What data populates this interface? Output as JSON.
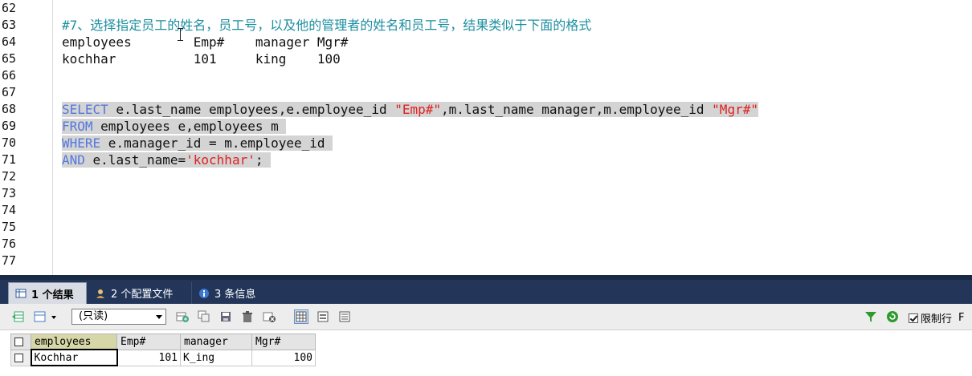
{
  "editor": {
    "lines": [
      {
        "n": "62"
      },
      {
        "n": "63",
        "comment": "#7、选择指定员工的姓名，员工号，以及他的管理者的姓名和员工号，结果类似于下面的格式"
      },
      {
        "n": "64",
        "text": "employees        Emp#    manager Mgr#"
      },
      {
        "n": "65",
        "text": "kochhar          101     king    100"
      },
      {
        "n": "66"
      },
      {
        "n": "67"
      },
      {
        "n": "68",
        "kw": "SELECT",
        "rest1": " e.last_name employees,e.employee_id ",
        "str1": "\"Emp#\"",
        "rest2": ",m.last_name manager,m.employee_id ",
        "str2": "\"Mgr#\""
      },
      {
        "n": "69",
        "kw": "FROM",
        "rest1": " employees e,employees m "
      },
      {
        "n": "70",
        "kw": "WHERE",
        "rest1": " e.manager_id = m.employee_id "
      },
      {
        "n": "71",
        "kw": "AND",
        "rest1": " e.last_name=",
        "str1": "'kochhar'",
        "rest2": ";"
      },
      {
        "n": "72"
      },
      {
        "n": "73"
      },
      {
        "n": "74"
      },
      {
        "n": "75"
      },
      {
        "n": "76"
      },
      {
        "n": "77"
      }
    ]
  },
  "tabs": [
    {
      "label": "1 个结果"
    },
    {
      "label": "2 个配置文件"
    },
    {
      "label": "3 条信息"
    }
  ],
  "toolbar": {
    "mode_select": "(只读)",
    "limit_label": "限制行",
    "limit_trailing": "F"
  },
  "grid": {
    "columns": [
      "employees",
      "Emp#",
      "manager",
      "Mgr#"
    ],
    "row": [
      "Kochhar",
      "101",
      "K_ing",
      "100"
    ]
  },
  "colors": {
    "keyword": "#5577dd",
    "string": "#e02020",
    "comment": "#1e8fa0",
    "tabbar": "#23365a"
  }
}
